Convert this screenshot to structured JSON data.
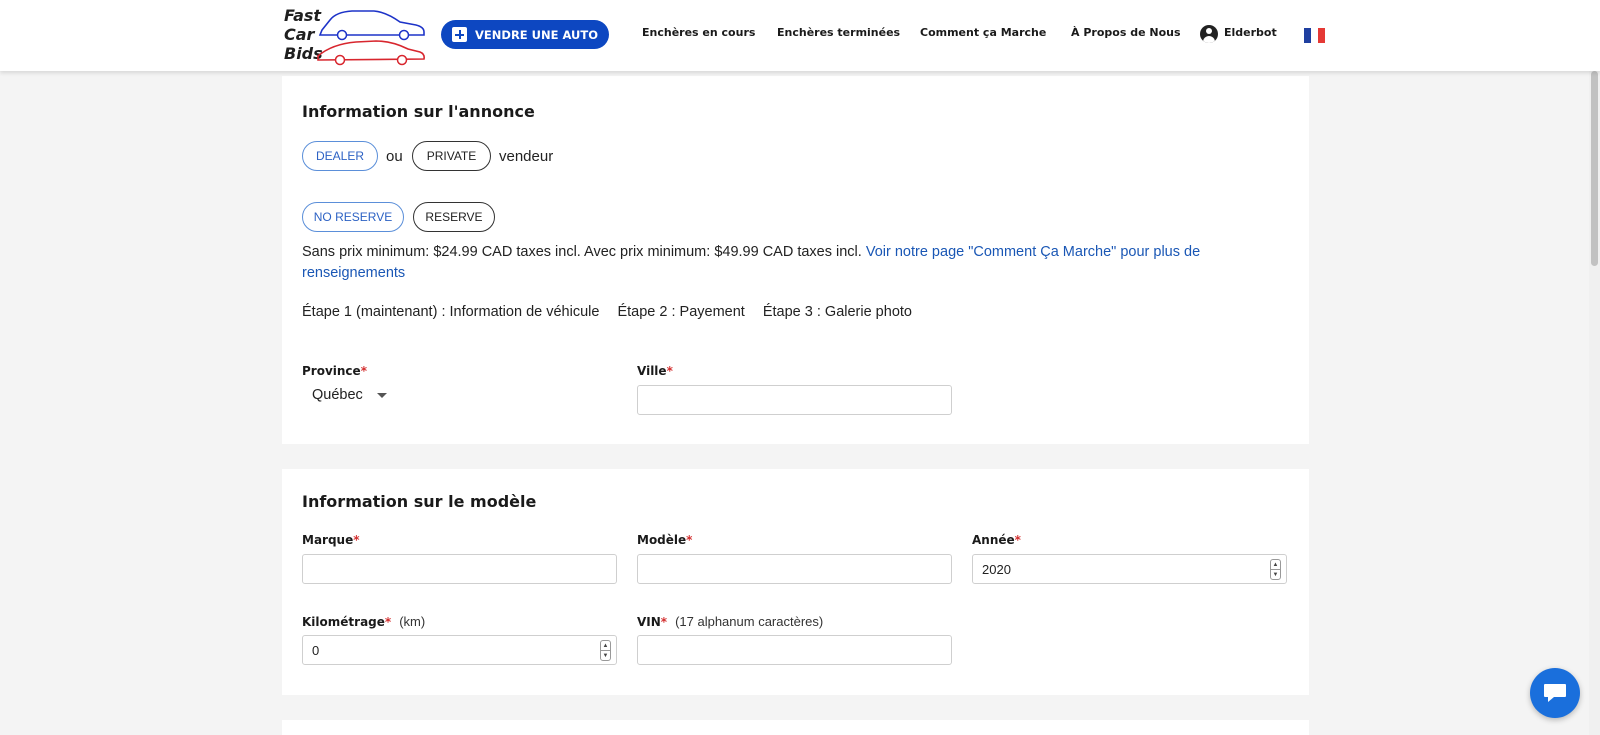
{
  "header": {
    "logo_lines": [
      "Fast",
      "Car",
      "Bids"
    ],
    "sell_label": "VENDRE UNE AUTO",
    "nav": [
      {
        "label": "Enchères en cours"
      },
      {
        "label": "Enchères terminées"
      },
      {
        "label": "Comment ça Marche"
      },
      {
        "label": "À Propos de Nous"
      }
    ],
    "user_name": "Elderbot",
    "flag_colors": [
      "#1f3fa0",
      "#ffffff",
      "#e53935"
    ]
  },
  "listing": {
    "title": "Information sur l'annonce",
    "dealer_label": "DEALER",
    "or_text": "ou",
    "private_label": "PRIVATE",
    "seller_text": "vendeur",
    "no_reserve_label": "NO RESERVE",
    "reserve_label": "RESERVE",
    "pricing_text": "Sans prix minimum: $24.99 CAD taxes incl. Avec prix minimum: $49.99 CAD taxes incl.",
    "pricing_link": "Voir notre page \"Comment Ça Marche\" pour plus de renseignements",
    "steps": [
      "Étape 1 (maintenant) : Information de véhicule",
      "Étape 2 : Payement",
      "Étape 3 : Galerie photo"
    ],
    "province_label": "Province",
    "province_value": "Québec",
    "city_label": "Ville",
    "city_value": ""
  },
  "model": {
    "title": "Information sur le modèle",
    "make_label": "Marque",
    "make_value": "",
    "model_label": "Modèle",
    "model_value": "",
    "year_label": "Année",
    "year_value": "2020",
    "mileage_label": "Kilométrage",
    "mileage_hint": "(km)",
    "mileage_value": "0",
    "vin_label": "VIN",
    "vin_hint": "(17 alphanum caractères)",
    "vin_value": ""
  },
  "required_mark": "*",
  "colors": {
    "primary": "#0d47c1",
    "link": "#1a57b5",
    "required": "#d32f2f",
    "chat": "#1a6fdc"
  }
}
